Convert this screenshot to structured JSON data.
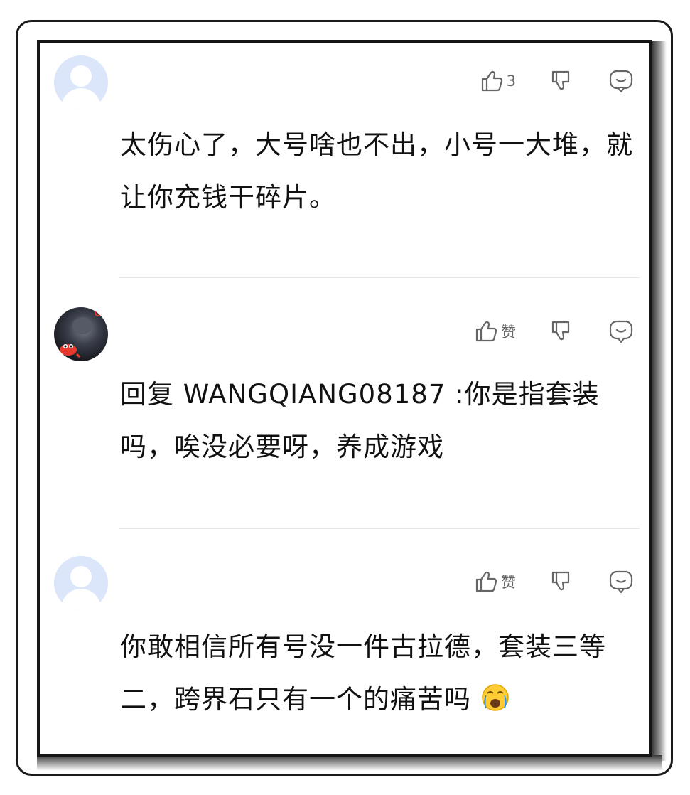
{
  "comments": [
    {
      "username": "",
      "like_label": "3",
      "text": "太伤心了，大号啥也不出，小号一大堆，就让你充钱干碎片。",
      "avatar": "default-avatar"
    },
    {
      "username": "",
      "like_label": "赞",
      "text": "回复 WANGQIANG08187 :你是指套装吗，唉没必要呀，养成游戏",
      "avatar": "photo-avatar"
    },
    {
      "username": "",
      "like_label": "赞",
      "text": "你敢相信所有号没一件古拉德，套装三等二，跨界石只有一个的痛苦吗",
      "emoji": "crying-emoji",
      "avatar": "default-avatar"
    }
  ],
  "icons": {
    "like": "thumbs-up-icon",
    "dislike": "thumbs-down-icon",
    "reply": "reply-bubble-icon"
  },
  "colors": {
    "text": "#111111",
    "icon": "#666666",
    "avatar_bg": "#dbe6fb",
    "divider": "#e6e6e6"
  }
}
